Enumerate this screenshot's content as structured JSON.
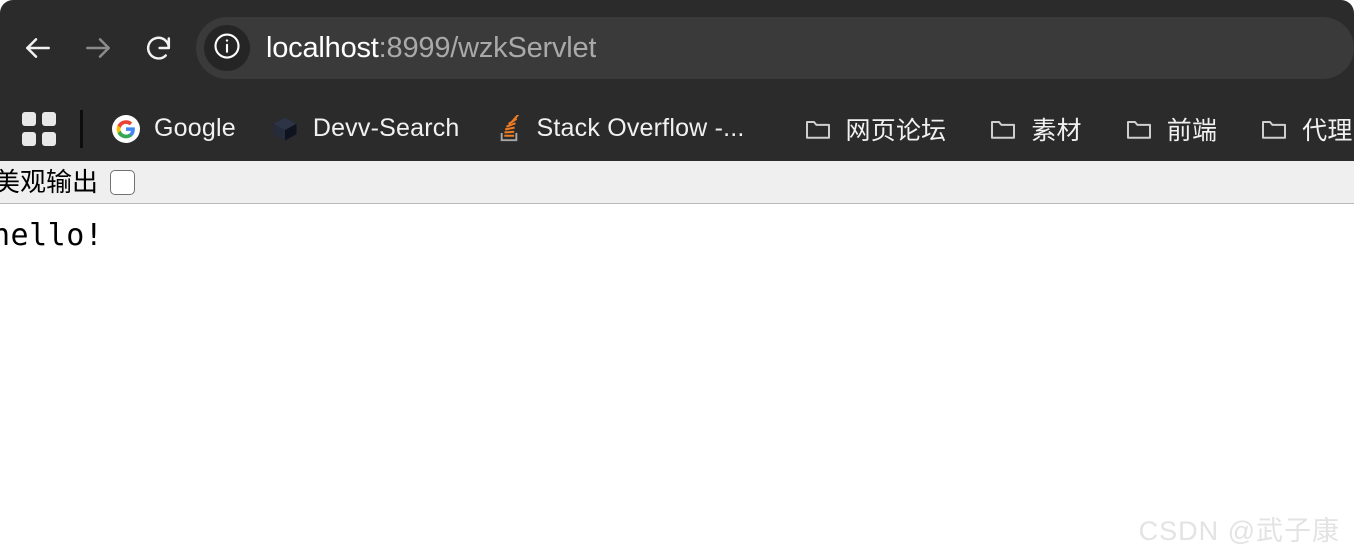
{
  "browser": {
    "nav": {
      "back_label": "Back",
      "back_icon": "arrow-left-icon",
      "forward_label": "Forward",
      "forward_icon": "arrow-right-icon",
      "reload_label": "Reload",
      "reload_icon": "reload-icon"
    },
    "omnibox": {
      "site_info_icon": "info-circle-icon",
      "url_host": "localhost",
      "url_rest": ":8999/wzkServlet",
      "url_full": "localhost:8999/wzkServlet"
    },
    "bookmarks": {
      "apps_icon": "apps-grid-icon",
      "items": [
        {
          "label": "Google",
          "icon": "google-favicon"
        },
        {
          "label": "Devv-Search",
          "icon": "devv-cube-icon"
        },
        {
          "label": "Stack Overflow -...",
          "icon": "stack-overflow-icon"
        },
        {
          "label": "网页论坛",
          "icon": "folder-icon"
        },
        {
          "label": "素材",
          "icon": "folder-icon"
        },
        {
          "label": "前端",
          "icon": "folder-icon"
        },
        {
          "label": "代理",
          "icon": "folder-icon"
        }
      ]
    }
  },
  "page": {
    "pretty_print_label": "美观输出",
    "pretty_print_checked": false,
    "body_text": "hello!",
    "watermark": "CSDN @武子康"
  },
  "colors": {
    "chrome_bg": "#2b2b2b",
    "omnibox_bg": "#3a3a3a",
    "page_bg": "#ffffff",
    "pretty_bar_bg": "#efefef",
    "watermark": "#e3e3e3",
    "accent_orange": "#e8804a"
  }
}
